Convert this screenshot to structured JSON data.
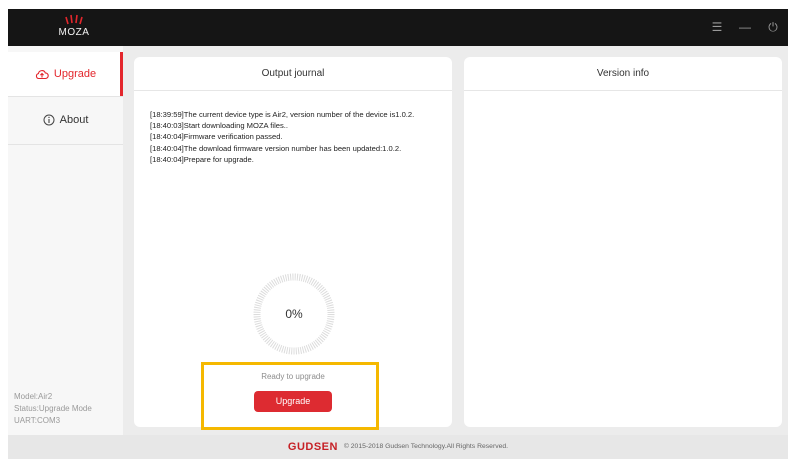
{
  "app": {
    "logo_text": "MOZA"
  },
  "window_controls": {
    "menu": "☰",
    "minimize": "—",
    "power": "⏻"
  },
  "sidebar": {
    "items": [
      {
        "label": "Upgrade",
        "icon": "cloud-upload-icon",
        "active": true
      },
      {
        "label": "About",
        "icon": "info-icon",
        "active": false
      }
    ],
    "device_info": {
      "model": "Model:Air2",
      "status": "Status:Upgrade Mode",
      "port": "UART:COM3"
    }
  },
  "output_journal": {
    "title": "Output journal",
    "log_lines": [
      "[18:39:59]The current device type is Air2, version number of the device is1.0.2.",
      "[18:40:03]Start downloading MOZA files..",
      "[18:40:04]Firmware verification passed.",
      "[18:40:04]The download firmware version number has been updated:1.0.2.",
      "[18:40:04]Prepare for upgrade."
    ],
    "progress": {
      "value": 0,
      "label": "0%"
    },
    "status": "Ready to upgrade",
    "upgrade_button": "Upgrade"
  },
  "version_info": {
    "title": "Version info"
  },
  "footer": {
    "brand": "GUDSEN",
    "copyright": "© 2015-2018 Gudsen Technology.All Rights Reserved."
  },
  "colors": {
    "accent": "#e3262c",
    "titlebar": "#151515",
    "highlight": "#f5b800"
  }
}
